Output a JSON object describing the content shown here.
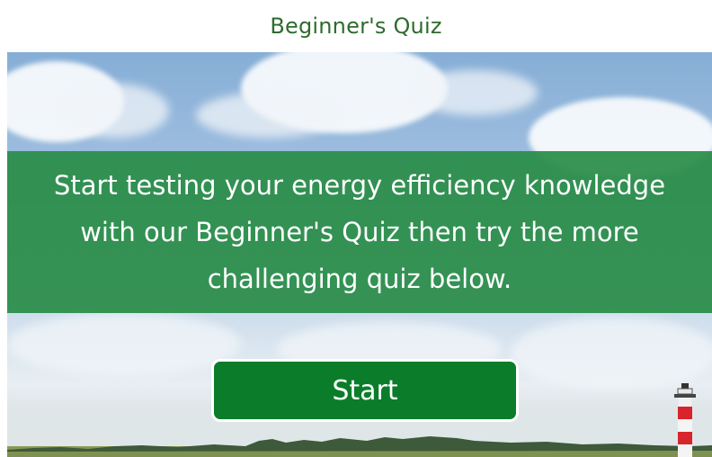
{
  "header": {
    "title": "Beginner's Quiz"
  },
  "hero": {
    "message": "Start testing your energy efficiency knowledge with our Beginner's Quiz then try the more challenging quiz below."
  },
  "actions": {
    "start_label": "Start"
  },
  "colors": {
    "title_green": "#2e6b2e",
    "banner_green": "#288c46",
    "button_green": "#0b7d2a"
  }
}
